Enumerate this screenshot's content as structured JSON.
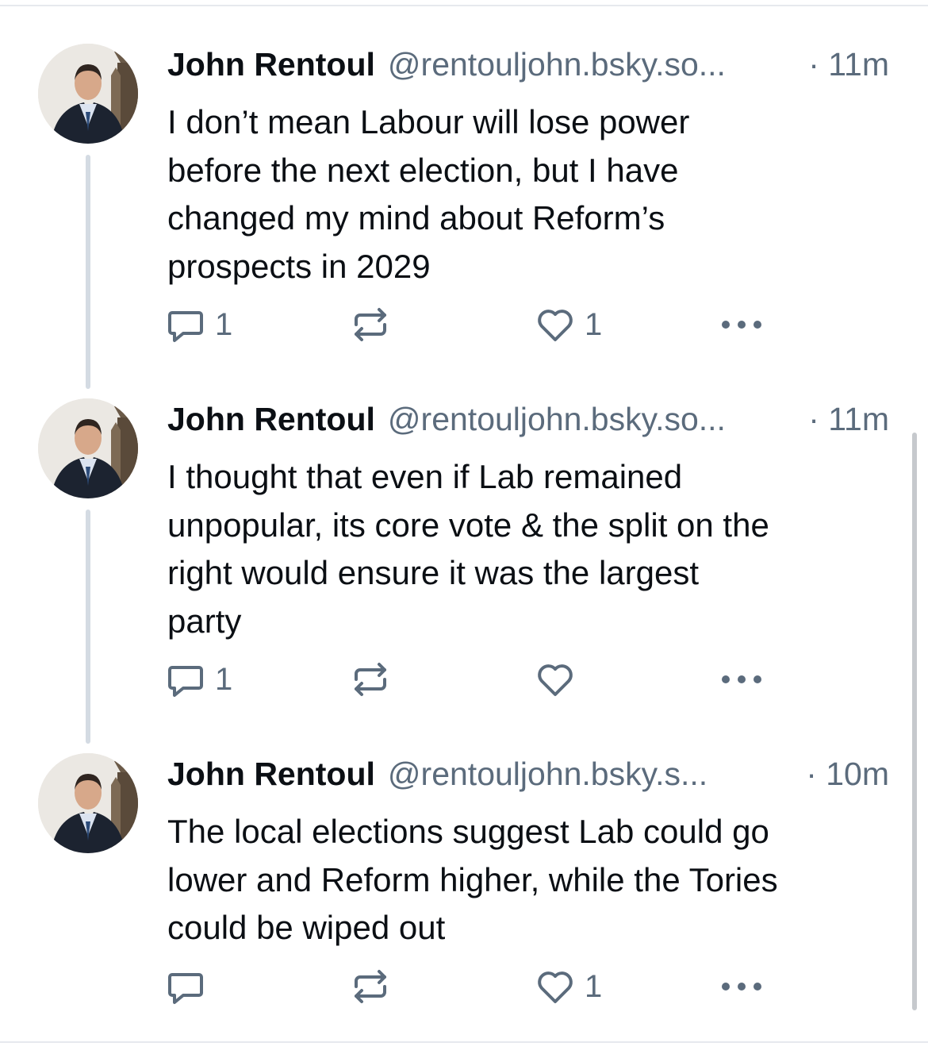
{
  "posts": [
    {
      "author": "John Rentoul",
      "handle": "@rentouljohn.bsky.so...",
      "time": "· 11m",
      "text": "I don’t mean Labour will lose power\nbefore the next election, but I have\nchanged my mind about Reform’s\nprospects in 2029",
      "reply_count": "1",
      "repost_count": "",
      "like_count": "1"
    },
    {
      "author": "John Rentoul",
      "handle": "@rentouljohn.bsky.so...",
      "time": "· 11m",
      "text": "I thought that even if Lab remained\nunpopular, its core vote & the split on the\nright would ensure it was the largest\nparty",
      "reply_count": "1",
      "repost_count": "",
      "like_count": ""
    },
    {
      "author": "John Rentoul",
      "handle": "@rentouljohn.bsky.s...",
      "time": "· 10m",
      "text": "The local elections suggest Lab could go\nlower and Reform higher, while the Tories\ncould be wiped out",
      "reply_count": "",
      "repost_count": "",
      "like_count": "1"
    }
  ],
  "icons": {
    "reply": "reply-icon",
    "repost": "repost-icon",
    "like": "heart-icon",
    "more": "more-options-icon"
  },
  "colors": {
    "text": "#0b0f14",
    "muted": "#5b6b7c",
    "thread_line": "#d4dbe3",
    "divider": "#e6e9ee"
  }
}
